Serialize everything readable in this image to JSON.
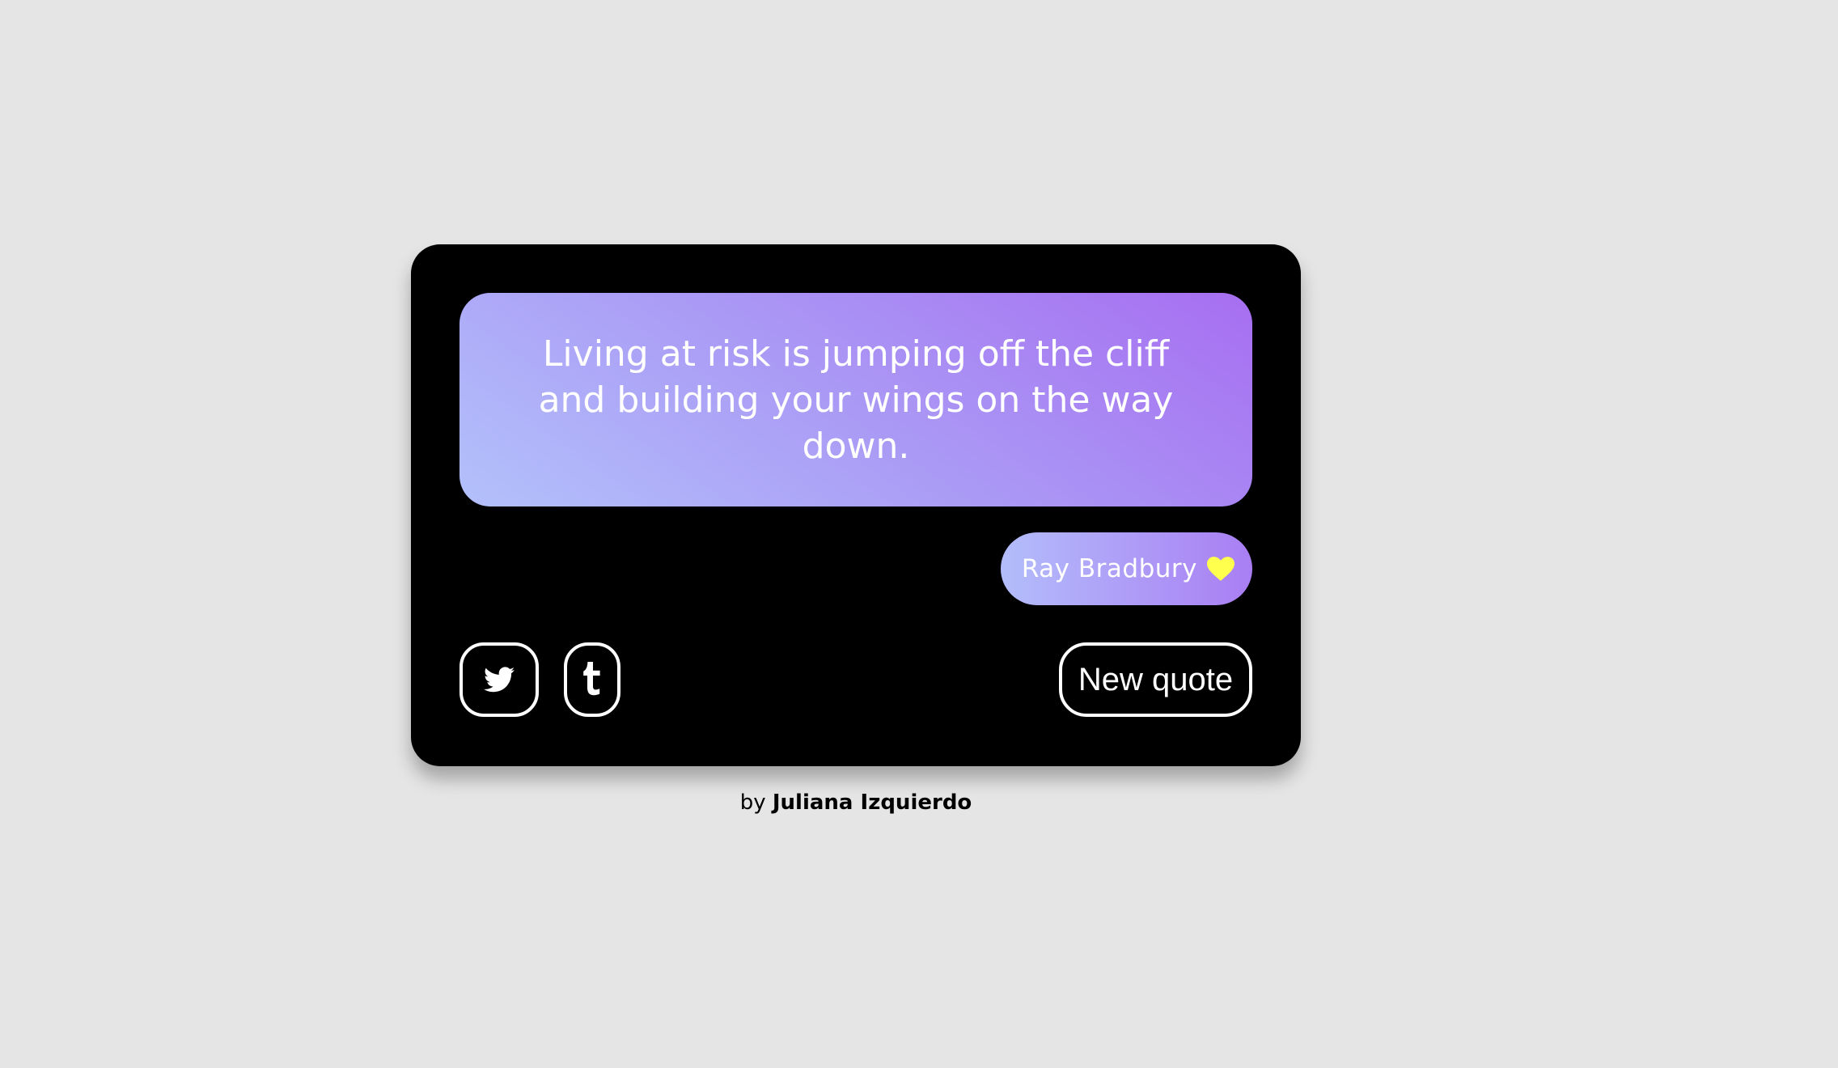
{
  "quote": {
    "text": "Living at risk is jumping off the cliff and building your wings on the way down.",
    "author": "Ray Bradbury"
  },
  "icons": {
    "heart": "heart-icon",
    "twitter": "twitter-icon",
    "tumblr": "tumblr-icon"
  },
  "actions": {
    "new_quote_label": "New quote"
  },
  "footer": {
    "by_label": "by",
    "author_name": "Juliana Izquierdo"
  },
  "colors": {
    "page_background": "#e5e5e5",
    "card_background": "#000000",
    "gradient_start": "#b3c1fb",
    "gradient_end": "#a76ef1",
    "heart": "#ffff4d",
    "text_light": "#ffffff"
  }
}
